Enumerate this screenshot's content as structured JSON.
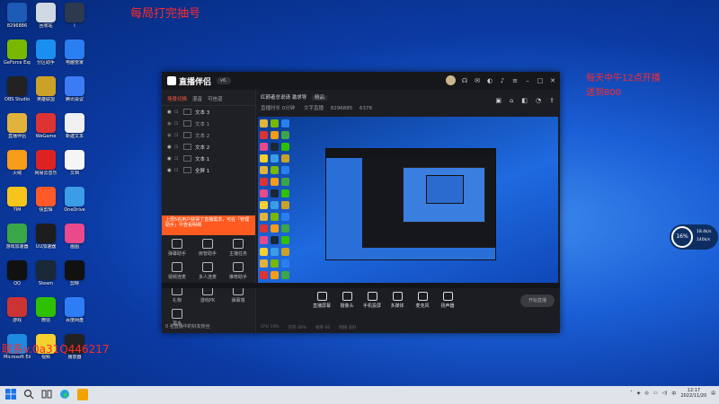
{
  "desktop": {
    "icons": [
      {
        "label": "8296886",
        "color": "#1e5bb6"
      },
      {
        "label": "回收站",
        "color": "#cfd8e3"
      },
      {
        "label": "i",
        "color": "#2d3a4e"
      },
      {
        "label": "GeForce Experience",
        "color": "#76b900"
      },
      {
        "label": "分区助手",
        "color": "#1a8ff0"
      },
      {
        "label": "电脑管家",
        "color": "#2a7ff0"
      },
      {
        "label": "OBS Studio",
        "color": "#222"
      },
      {
        "label": "英雄联盟",
        "color": "#c9a227"
      },
      {
        "label": "腾讯会议",
        "color": "#3b7cf5"
      },
      {
        "label": "直播伴侣",
        "color": "#e2b33c"
      },
      {
        "label": "WeGame",
        "color": "#d33"
      },
      {
        "label": "新建文本",
        "color": "#f0f0f0"
      },
      {
        "label": "火绒",
        "color": "#f59c1a"
      },
      {
        "label": "网易云音乐",
        "color": "#d22"
      },
      {
        "label": "文档",
        "color": "#f5f5f5"
      },
      {
        "label": "TIM",
        "color": "#f7c41c"
      },
      {
        "label": "快剪辑",
        "color": "#ff5a28"
      },
      {
        "label": "OneDrive",
        "color": "#3b9ce8"
      },
      {
        "label": "游戏加速器",
        "color": "#3aa648"
      },
      {
        "label": "UU加速器",
        "color": "#1d1d1d"
      },
      {
        "label": "画图",
        "color": "#e94a8b"
      },
      {
        "label": "QQ",
        "color": "#111"
      },
      {
        "label": "Steam",
        "color": "#1b2838"
      },
      {
        "label": "剪映",
        "color": "#111"
      },
      {
        "label": "游戏",
        "color": "#c33"
      },
      {
        "label": "微信",
        "color": "#2dc100"
      },
      {
        "label": "百度网盘",
        "color": "#2f7df6"
      },
      {
        "label": "Microsoft Edge",
        "color": "#1c8be0"
      },
      {
        "label": "视频",
        "color": "#f5d130"
      },
      {
        "label": "播放器",
        "color": "#222"
      }
    ],
    "overlay_top": "每局打完抽号",
    "overlay_right_1": "每天中午12点开播",
    "overlay_right_2": "送到800",
    "overlay_bottom": "联系v.0a31Q446217"
  },
  "app": {
    "name": "直播伴侣",
    "version": "v6.",
    "tabs": [
      "场景切换",
      "混音",
      "可信道"
    ],
    "scenes": [
      {
        "label": "文本 3",
        "bright": true
      },
      {
        "label": "文本 1",
        "bright": false
      },
      {
        "label": "文本 2",
        "bright": false
      },
      {
        "label": "文本 2",
        "bright": true
      },
      {
        "label": "文本 1",
        "bright": true
      },
      {
        "label": "全屏 1",
        "bright": true
      }
    ],
    "banner": "上周5名用户获得了直播需求，可在「管理助手」中查看明细",
    "tools": [
      {
        "label": "弹幕助手"
      },
      {
        "label": "房管助手"
      },
      {
        "label": "主播任务"
      },
      {
        "label": "视频连麦"
      },
      {
        "label": "多人连麦"
      },
      {
        "label": "推荐助手"
      },
      {
        "label": "礼物"
      },
      {
        "label": "游戏PK"
      },
      {
        "label": "弹幕墙"
      },
      {
        "label": "更多"
      }
    ],
    "footer": "0 名直播中的好友粉丝",
    "info_title": "红颜者总说请 激求导",
    "info_tag": "精品",
    "info_sub": "直播时长  0分钟",
    "info_id": "文字直播",
    "info_num": "8296885",
    "info_count": "6378",
    "controls": [
      {
        "label": "直播屏幕"
      },
      {
        "label": "摄像头"
      },
      {
        "label": "手机投屏"
      },
      {
        "label": "多媒体"
      },
      {
        "label": "麦克风"
      },
      {
        "label": "扬声器"
      }
    ],
    "start_live": "开始直播",
    "status_items": [
      "CPU 19%",
      "内存 48%",
      "帧率 60",
      "网络 良好"
    ]
  },
  "widget": {
    "pct": "16%",
    "up": "18.4k/s",
    "down": "140k/s"
  },
  "taskbar": {
    "time": "12:17",
    "date": "2022/11/20"
  }
}
